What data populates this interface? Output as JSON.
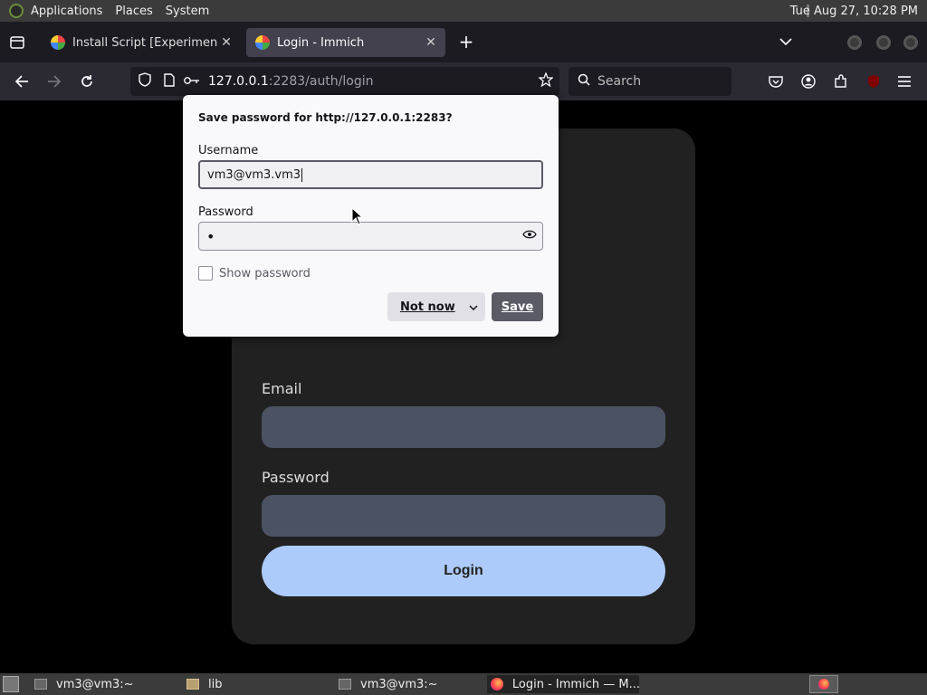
{
  "system_panel": {
    "menus": [
      "Applications",
      "Places",
      "System"
    ],
    "clock": "Tue Aug 27, 10:28 PM"
  },
  "browser": {
    "tabs": [
      {
        "title": "Install Script [Experimental]",
        "active": false
      },
      {
        "title": "Login - Immich",
        "active": true
      }
    ],
    "url_host": "127.0.0.1",
    "url_rest": ":2283/auth/login",
    "search_placeholder": "Search"
  },
  "page": {
    "email_label": "Email",
    "password_label": "Password",
    "login_button": "Login"
  },
  "password_popup": {
    "heading": "Save password for http://127.0.0.1:2283?",
    "username_label": "Username",
    "username_value": "vm3@vm3.vm3",
    "password_label": "Password",
    "password_value": "•",
    "show_password_label": "Show password",
    "not_now_label": "Not now",
    "save_label": "Save"
  },
  "taskbar": {
    "items": [
      "vm3@vm3:~",
      "lib",
      "vm3@vm3:~",
      "Login - Immich — M..."
    ]
  },
  "colors": {
    "accent_button": "#adcbfa",
    "card_bg": "#212121",
    "input_bg": "#4b5262"
  }
}
